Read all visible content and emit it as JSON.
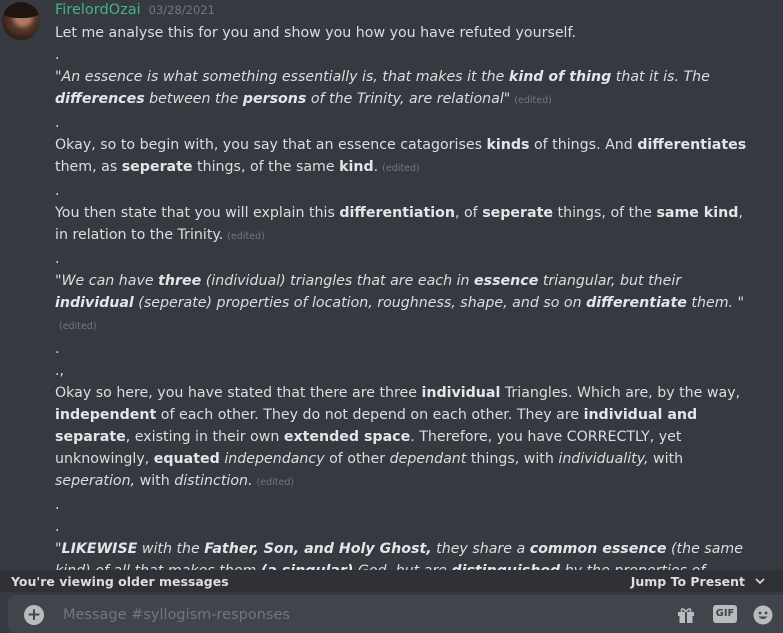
{
  "message": {
    "username": "FirelordOzai",
    "timestamp": "03/28/2021",
    "edited_label": "(edited)",
    "dot": ".",
    "dot_comma": ".,",
    "line1": "Let me analyse this for you and show you how you have refuted yourself.",
    "p2": {
      "a": "\"An essence is what something essentially is, that makes it the ",
      "b1": "kind of thing",
      "c": " that it is. The ",
      "b2": "differences",
      "d": " between the ",
      "b3": "persons",
      "e": " of the Trinity, are relational\""
    },
    "p3": {
      "a": "Okay, so to begin with, you say that an essence catagorises ",
      "b1": "kinds",
      "c": " of things. And ",
      "b2": "differentiates",
      "d": " them, as ",
      "b3": "seperate",
      "e": " things, of the same ",
      "b4": "kind",
      "f": "."
    },
    "p4": {
      "a": "You then state that you will explain this ",
      "b1": "differentiation",
      "c": ", of ",
      "b2": "seperate",
      "d": " things, of the ",
      "b3": "same kind",
      "e": ", in relation to the Trinity."
    },
    "p5": {
      "a": "\"We can have ",
      "b1": "three",
      "c": " (individual) triangles that are each in ",
      "b2": "essence",
      "d": " triangular, but their ",
      "b3": "individual",
      "e": " (seperate) properties of location, roughness, shape, and so on ",
      "b4": "differentiate",
      "f": " them. \""
    },
    "p6": {
      "a": "Okay so here, you have stated that there are three ",
      "b1": "individual",
      "c": " Triangles. Which are, by the way, ",
      "b2": "independent",
      "d": " of each other. They do not depend on each other. They are ",
      "b3": "individual and separate",
      "e": ", existing in their own ",
      "b4": "extended space",
      "f": ". Therefore, you have CORRECTLY, yet unknowingly, ",
      "b5": "equated",
      "g": " ",
      "i1": "independancy",
      "h": " of other ",
      "i2": "dependant",
      "j": " things, with ",
      "i3": "individuality,",
      "k": " with ",
      "i4": "seperation,",
      "l": " with ",
      "i5": "distinction."
    },
    "p7": {
      "a": "\"",
      "b1": "LIKEWISE",
      "c": " with the ",
      "b2": "Father, Son, and Holy Ghost,",
      "d": " they share a  ",
      "b3": "common essence",
      "e": " (the same kind) of all that makes them ",
      "b4": "(a singular)",
      "f": " God, but are ",
      "b5": "distinguished",
      "g": " by the properties of Paternity, Sonship,"
    }
  },
  "older_bar": {
    "text": "You're viewing older messages",
    "jump_label": "Jump To Present"
  },
  "composer": {
    "placeholder": "Message #syllogism-responses",
    "gif_label": "GIF"
  },
  "icons": [
    "plus-icon",
    "gift-icon",
    "gif-icon",
    "emoji-icon",
    "chevron-down-icon"
  ]
}
